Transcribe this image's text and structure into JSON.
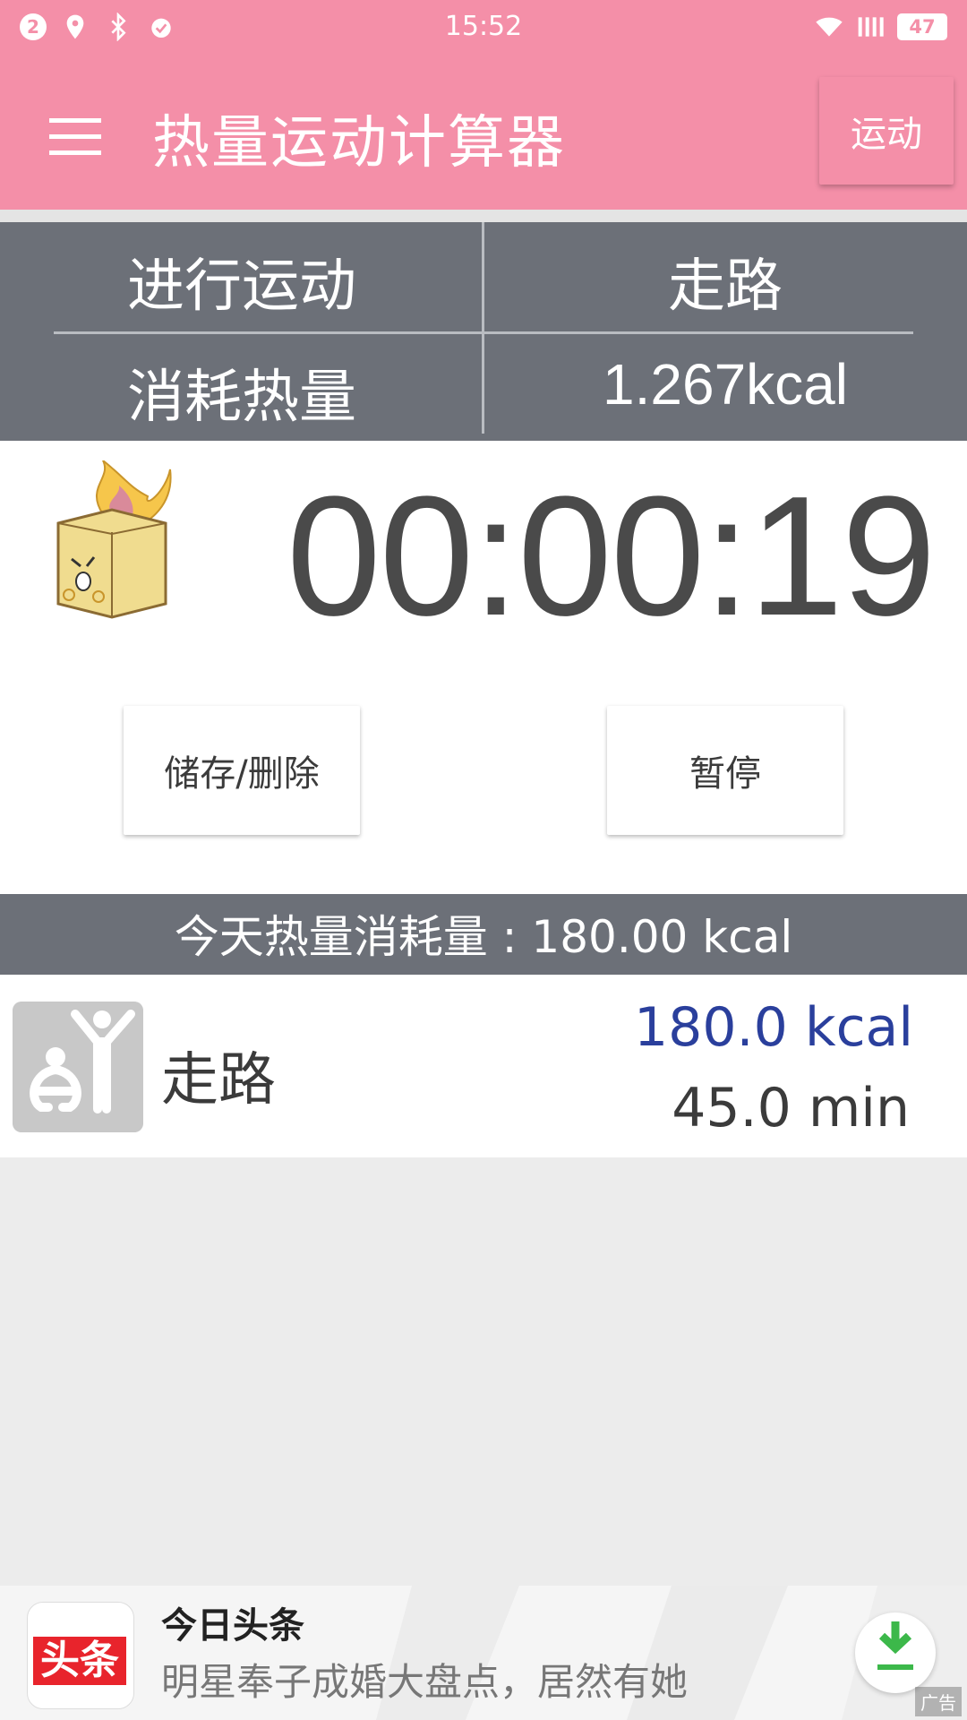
{
  "status_bar": {
    "notification_count": "2",
    "time": "15:52",
    "battery": "47",
    "icons": [
      "notification-badge-icon",
      "location-icon",
      "bluetooth-icon",
      "alarm-icon",
      "wifi-icon",
      "signal-icon",
      "battery-icon"
    ]
  },
  "app_bar": {
    "title": "热量运动计算器",
    "action_label": "运动",
    "color": "#f48fa8"
  },
  "info": {
    "activity_label": "进行运动",
    "activity_value": "走路",
    "calories_label": "消耗热量",
    "calories_value": "1.267kcal",
    "color": "#6c7078"
  },
  "timer": {
    "value": "00:00:19",
    "save_delete_label": "储存/删除",
    "pause_label": "暂停"
  },
  "today": {
    "summary": "今天热量消耗量 : 180.00 kcal"
  },
  "list": {
    "items": [
      {
        "label": "走路",
        "kcal": "180.0 kcal",
        "minutes": "45.0 min",
        "icon": "exercise-person-icon"
      }
    ]
  },
  "ad": {
    "logo_text": "头条",
    "title": "今日头条",
    "subtitle": "明星奉子成婚大盘点，居然有她",
    "tag": "广告"
  }
}
